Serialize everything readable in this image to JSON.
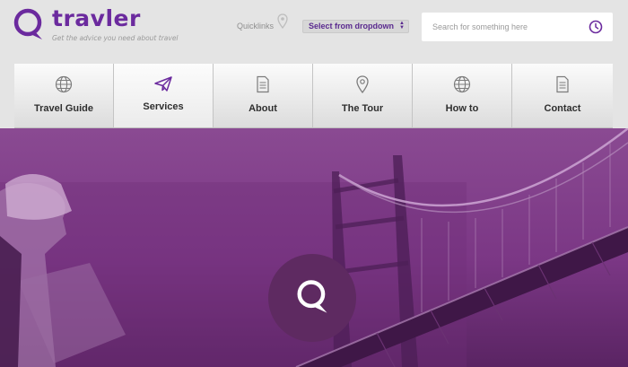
{
  "brand": {
    "name": "travler",
    "tagline": "Get the advice you need about travel",
    "logo_icon": "chat-bubble-q-icon",
    "color": "#6b2a9e"
  },
  "quicklinks": {
    "label": "Quicklinks",
    "icon": "map-pin-icon",
    "dropdown_value": "Select from dropdown"
  },
  "search": {
    "placeholder": "Search for something here",
    "button_icon": "clock-search-icon"
  },
  "nav": {
    "items": [
      {
        "label": "Travel Guide",
        "icon": "globe-icon",
        "active": false
      },
      {
        "label": "Services",
        "icon": "paper-plane-icon",
        "active": true
      },
      {
        "label": "About",
        "icon": "document-icon",
        "active": false
      },
      {
        "label": "The Tour",
        "icon": "map-pin-icon",
        "active": false
      },
      {
        "label": "How to",
        "icon": "globe-icon",
        "active": false
      },
      {
        "label": "Contact",
        "icon": "document-icon",
        "active": false
      }
    ]
  },
  "hero": {
    "image": "purple-tinted-bridge-and-traveler-photo",
    "badge_icon": "chat-bubble-q-icon",
    "tint": "#7a2f83"
  },
  "colors": {
    "accent": "#6b2a9e",
    "header_bg": "#e4e4e4",
    "hero_tint": "#7a2f83"
  }
}
